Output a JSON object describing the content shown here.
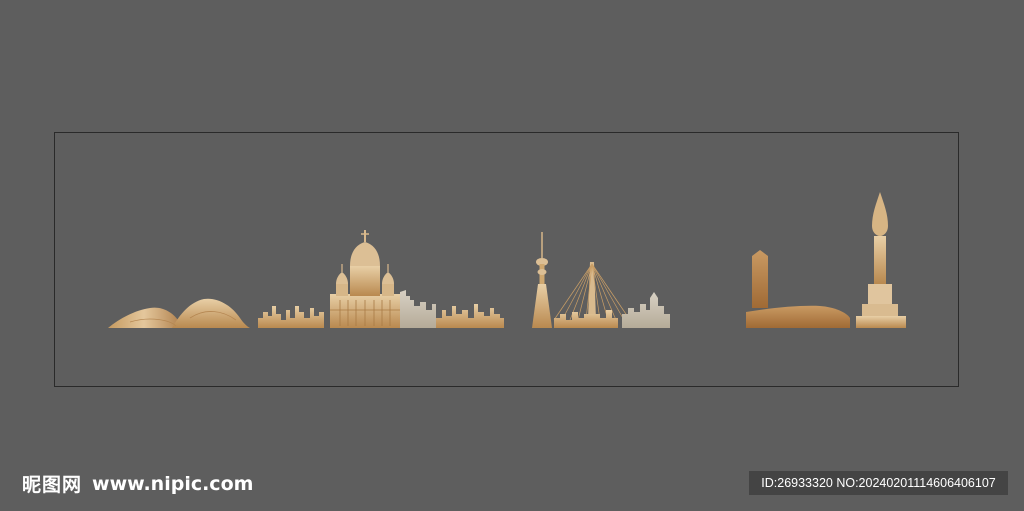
{
  "colors": {
    "background": "#5e5e5e",
    "frame_border": "#2a2a2a",
    "gold_light": "#e2c49c",
    "gold_mid": "#c9a06b",
    "gold_dark": "#a8743d",
    "gray_light": "#cfc8bb",
    "watermark_text": "#ffffff",
    "id_bar_bg": "#444444"
  },
  "watermark": {
    "brand": "昵图网",
    "url": "www.nipic.com"
  },
  "id_bar": {
    "text": "ID:26933320 NO:20240201114606406107"
  }
}
